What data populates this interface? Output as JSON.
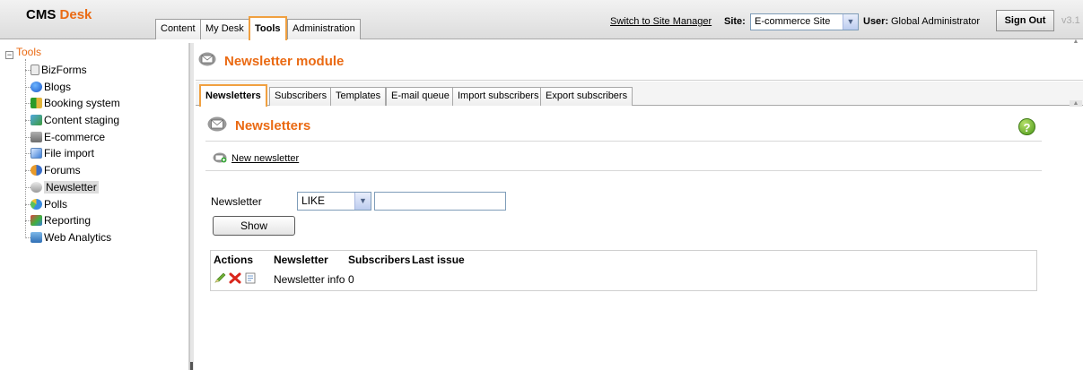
{
  "header": {
    "logo_cms": "CMS",
    "logo_desk": "Desk",
    "tabs": [
      {
        "label": "Content"
      },
      {
        "label": "My Desk"
      },
      {
        "label": "Tools"
      },
      {
        "label": "Administration"
      }
    ],
    "switch_link": "Switch to Site Manager",
    "site_label": "Site:",
    "site_value": "E-commerce Site",
    "user_label": "User:",
    "user_name": "Global Administrator",
    "sign_out": "Sign Out",
    "version": "v3.1"
  },
  "tree": {
    "root": "Tools",
    "items": [
      {
        "label": "BizForms",
        "icon": "form-icon"
      },
      {
        "label": "Blogs",
        "icon": "blog-icon"
      },
      {
        "label": "Booking system",
        "icon": "booking-icon"
      },
      {
        "label": "Content staging",
        "icon": "staging-icon"
      },
      {
        "label": "E-commerce",
        "icon": "cart-icon"
      },
      {
        "label": "File import",
        "icon": "file-import-icon"
      },
      {
        "label": "Forums",
        "icon": "forums-icon"
      },
      {
        "label": "Newsletter",
        "icon": "newsletter-icon"
      },
      {
        "label": "Polls",
        "icon": "polls-icon"
      },
      {
        "label": "Reporting",
        "icon": "reporting-icon"
      },
      {
        "label": "Web Analytics",
        "icon": "analytics-icon"
      }
    ],
    "selected": "Newsletter"
  },
  "module": {
    "title": "Newsletter module",
    "tabs": [
      {
        "label": "Newsletters"
      },
      {
        "label": "Subscribers"
      },
      {
        "label": "Templates"
      },
      {
        "label": "E-mail queue"
      },
      {
        "label": "Import subscribers"
      },
      {
        "label": "Export subscribers"
      }
    ]
  },
  "page": {
    "title": "Newsletters",
    "new_link": "New newsletter",
    "filter_label": "Newsletter",
    "filter_operator": "LIKE",
    "filter_value": "",
    "show_button": "Show",
    "grid": {
      "columns": [
        "Actions",
        "Newsletter",
        "Subscribers",
        "Last issue"
      ],
      "rows": [
        {
          "name": "Newsletter info",
          "subscribers": "0",
          "last_issue": ""
        }
      ]
    }
  },
  "colors": {
    "accent_orange": "#ea6a13",
    "tab_highlight": "#f0a040"
  }
}
